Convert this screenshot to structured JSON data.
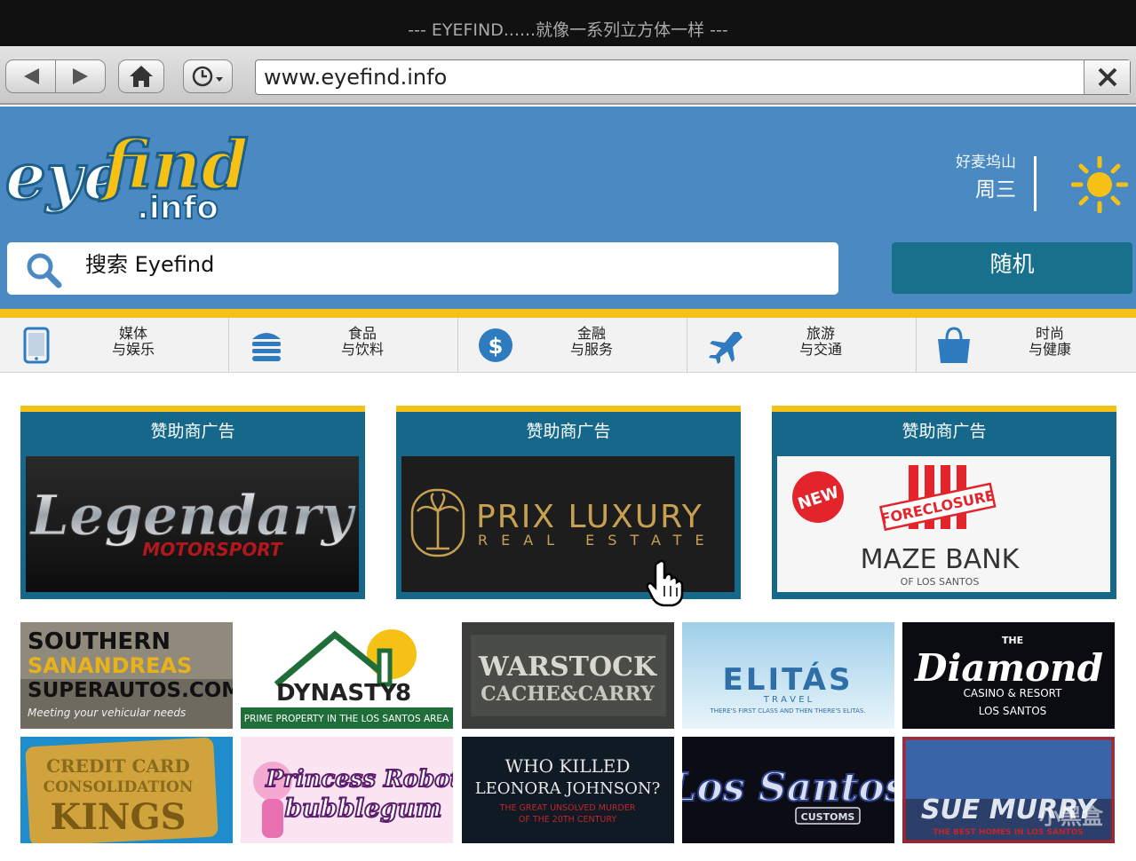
{
  "window": {
    "title": "--- EYEFIND......就像一系列立方体一样 ---"
  },
  "browser": {
    "url": "www.eyefind.info"
  },
  "header": {
    "logo_text": "eyefind.info",
    "location": "好麦坞山",
    "weekday": "周三",
    "search_label": "搜索 Eyefind",
    "random_label": "随机"
  },
  "categories": [
    {
      "line1": "媒体",
      "line2": "与娱乐",
      "icon": "tablet-icon"
    },
    {
      "line1": "食品",
      "line2": "与饮料",
      "icon": "burger-icon"
    },
    {
      "line1": "金融",
      "line2": "与服务",
      "icon": "dollar-icon"
    },
    {
      "line1": "旅游",
      "line2": "与交通",
      "icon": "airplane-icon"
    },
    {
      "line1": "时尚",
      "line2": "与健康",
      "icon": "shopping-bag-icon"
    }
  ],
  "sponsors": [
    {
      "title": "赞助商广告",
      "name": "Legendary",
      "sub": "MOTORSPORT"
    },
    {
      "title": "赞助商广告",
      "name": "PRIX LUXURY",
      "sub": "REAL ESTATE"
    },
    {
      "title": "赞助商广告",
      "name": "MAZE BANK",
      "sub": "OF LOS SANTOS",
      "badge": "NEW",
      "stamp": "FORECLOSURE"
    }
  ],
  "tiles": {
    "southern": {
      "line1": "SOUTHERN",
      "line2": "SANANDREAS",
      "line3": "SUPERAUTOS.COM",
      "tag": "Meeting your vehicular needs"
    },
    "dynasty": {
      "name": "DYNASTY",
      "num": "8",
      "tag": "PRIME PROPERTY IN THE LOS SANTOS AREA"
    },
    "warstock": {
      "line1": "WARSTOCK",
      "line2": "CACHE&CARRY"
    },
    "elitas": {
      "name": "ELITÁS",
      "sub": "T R A V E L",
      "tag": "THERE'S FIRST CLASS AND THEN THERE'S ELITAS."
    },
    "diamond": {
      "the": "THE",
      "name": "Diamond",
      "line1": "CASINO & RESORT",
      "line2": "LOS SANTOS"
    },
    "credit": {
      "line1": "CREDIT CARD",
      "line2": "CONSOLIDATION",
      "line3": "KINGS"
    },
    "princess": {
      "line1": "Princess Robot",
      "line2": "bubblegum"
    },
    "leonora": {
      "line1": "WHO KILLED",
      "line2": "LEONORA JOHNSON?",
      "line3": "THE GREAT UNSOLVED MURDER",
      "line4": "OF THE 20TH CENTURY"
    },
    "lossantos": {
      "name": "Los Santos",
      "sub": "CUSTOMS"
    },
    "suemurry": {
      "name": "SUE MURRY",
      "tag": "THE BEST HOMES IN LOS SANTOS",
      "watermark": "小黑盒"
    }
  },
  "colors": {
    "header_blue": "#4b89c3",
    "teal": "#15688a",
    "yellow": "#f4c114"
  }
}
